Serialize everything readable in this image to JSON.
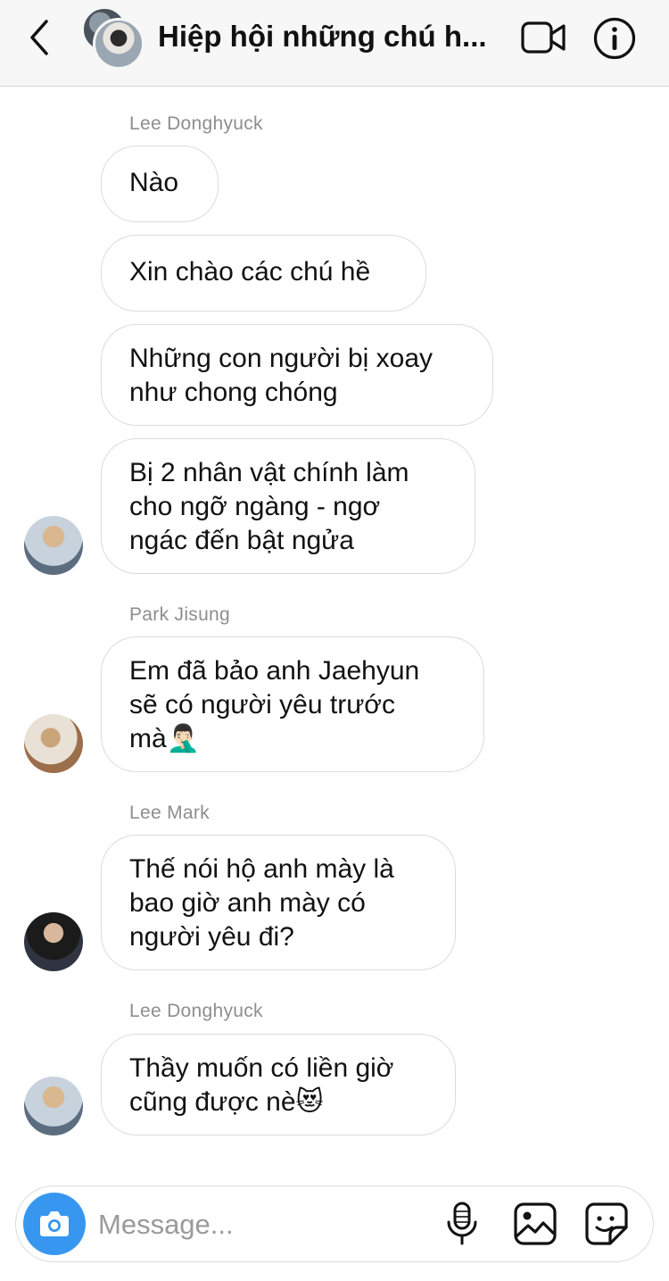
{
  "header": {
    "title": "Hiệp hội những chú h...",
    "back_icon": "chevron-left-icon",
    "video_icon": "video-camera-icon",
    "info_icon": "info-icon"
  },
  "messages": [
    {
      "sender": "Lee Donghyuck",
      "lines": [
        "Nào"
      ]
    },
    {
      "lines": [
        "Xin chào các chú hề"
      ]
    },
    {
      "lines": [
        "Những con người bị xoay",
        "như chong chóng"
      ]
    },
    {
      "lines": [
        "Bị 2 nhân vật chính làm",
        "cho ngỡ ngàng - ngơ",
        "ngác đến bật ngửa"
      ]
    },
    {
      "sender": "Park Jisung",
      "lines": [
        "Em đã bảo anh Jaehyun",
        "sẽ có người yêu trước",
        "mà"
      ],
      "emoji": "🤦🏻‍♂️"
    },
    {
      "sender": "Lee Mark",
      "lines": [
        "Thế nói hộ anh mày là",
        "bao giờ anh mày có",
        "người yêu đi?"
      ]
    },
    {
      "sender": "Lee Donghyuck",
      "lines": [
        "Thầy muốn có liền giờ",
        "cũng được nè"
      ],
      "emoji": "😻"
    }
  ],
  "composer": {
    "placeholder": "Message...",
    "camera_icon": "camera-icon",
    "mic_icon": "microphone-icon",
    "gallery_icon": "image-icon",
    "sticker_icon": "sticker-icon"
  },
  "colors": {
    "accent": "#3797f0",
    "bubble_border": "#dbdbdb",
    "sender_text": "#8e8e8e"
  }
}
